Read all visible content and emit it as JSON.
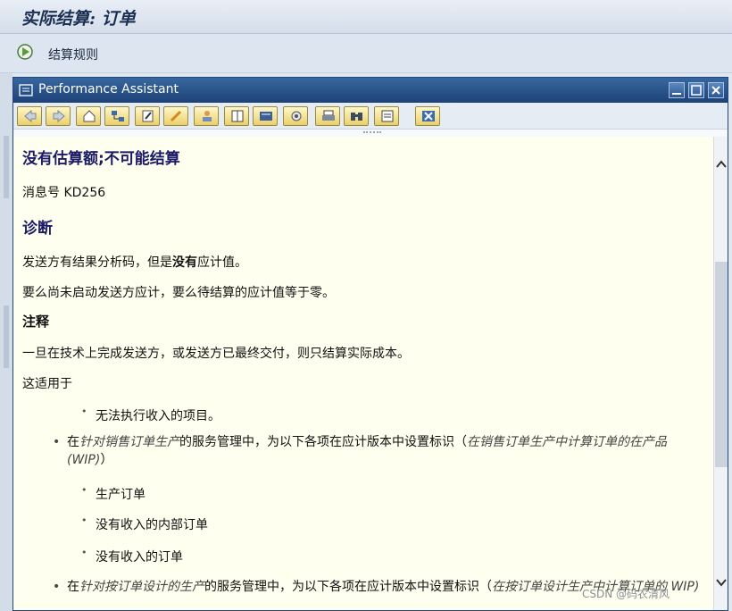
{
  "app": {
    "title": "实际结算: 订单",
    "toolbar": {
      "rules_label": "结算规则"
    }
  },
  "popup": {
    "title": "Performance Assistant",
    "toolbar_icons": [
      "back-icon",
      "forward-icon",
      "home-icon",
      "structure-icon",
      "edit-icon",
      "highlight-icon",
      "user-icon",
      "book-icon",
      "document-icon",
      "settings-icon",
      "print-icon",
      "find-icon",
      "page-icon",
      "close-icon"
    ],
    "content": {
      "heading": "没有估算额;不可能结算",
      "message_no": "消息号 KD256",
      "diagnosis_heading": "诊断",
      "diag_p1_prefix": "发送方有结果分析码，但是",
      "diag_p1_bold": "没有",
      "diag_p1_suffix": "应计值。",
      "diag_p2": "要么尚未启动发送方应计，要么待结算的应计值等于零。",
      "note_heading": "注释",
      "note_p1": "一旦在技术上完成发送方，或发送方已最终交付，则只结算实际成本。",
      "applies_to": "这适用于",
      "sub_item_a": "无法执行收入的项目。",
      "bullet1_prefix": "在",
      "bullet1_italic": "针对销售订单生产",
      "bullet1_middle": "的服务管理中，为以下各项在应计版本中设置标识（",
      "bullet1_italic2": "在销售订单生产中计算订单的在产品 (WIP)",
      "bullet1_suffix": "）",
      "sub_items_b": [
        "生产订单",
        "没有收入的内部订单",
        "没有收入的订单"
      ],
      "bullet2_prefix": "在",
      "bullet2_italic": "针对按订单设计的生产",
      "bullet2_middle": "的服务管理中，为以下各项在应计版本中设置标识（",
      "bullet2_italic2": "在按订单设计生产中计算订单的 WIP)"
    }
  },
  "watermark": "CSDN @码农清风",
  "colors": {
    "title_bar": "#1d4278",
    "content_bg": "#fffff0",
    "heading": "#1a1a66",
    "button_gold": "#e9cf6b"
  }
}
